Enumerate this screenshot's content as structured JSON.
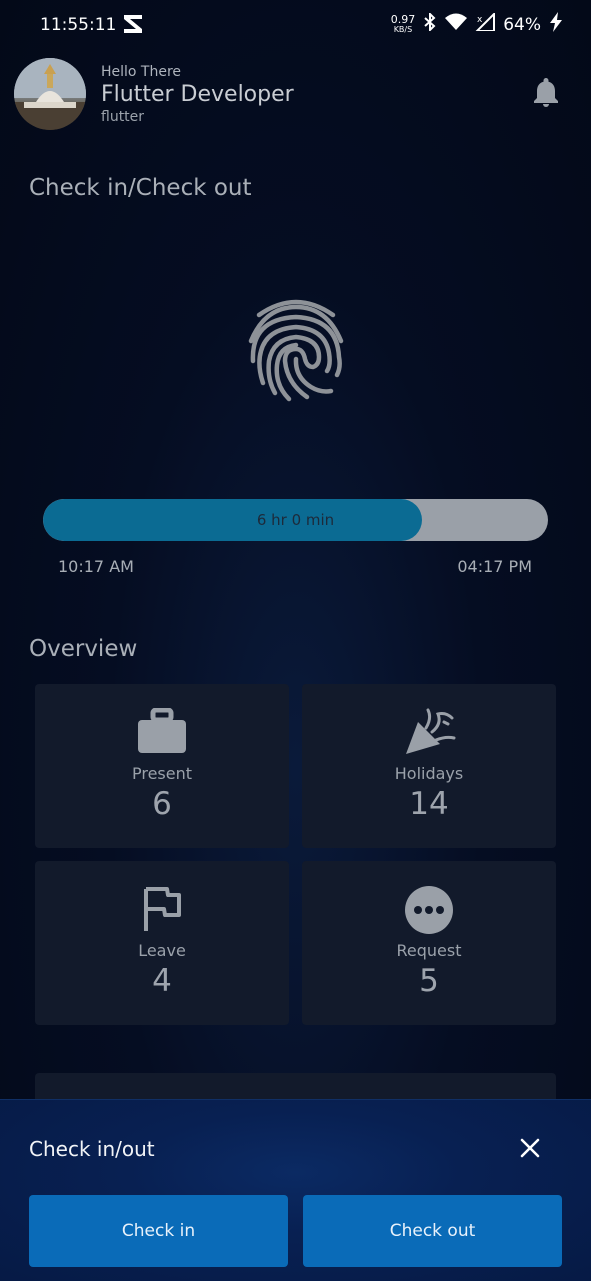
{
  "status_bar": {
    "time": "11:55:11",
    "net_speed_value": "0.97",
    "net_speed_unit": "KB/S",
    "battery": "64%"
  },
  "header": {
    "greeting": "Hello There",
    "name": "Flutter Developer",
    "role": "flutter",
    "bell_icon": "notification-bell"
  },
  "checkin": {
    "section_title": "Check in/Check out",
    "duration_label": "6 hr 0 min",
    "progress_fraction": 0.75,
    "start_time": "10:17 AM",
    "end_time": "04:17 PM"
  },
  "overview": {
    "title": "Overview",
    "cards": [
      {
        "label": "Present",
        "value": "6",
        "icon": "briefcase-icon"
      },
      {
        "label": "Holidays",
        "value": "14",
        "icon": "party-popper-icon"
      },
      {
        "label": "Leave",
        "value": "4",
        "icon": "flag-icon"
      },
      {
        "label": "Request",
        "value": "5",
        "icon": "more-horiz-icon"
      }
    ]
  },
  "bottom_sheet": {
    "title": "Check in/out",
    "check_in_label": "Check in",
    "check_out_label": "Check out"
  },
  "colors": {
    "background": "#050d22",
    "card": "#121a2b",
    "progress_fill": "#0b6b93",
    "button": "#0a6bb8"
  }
}
